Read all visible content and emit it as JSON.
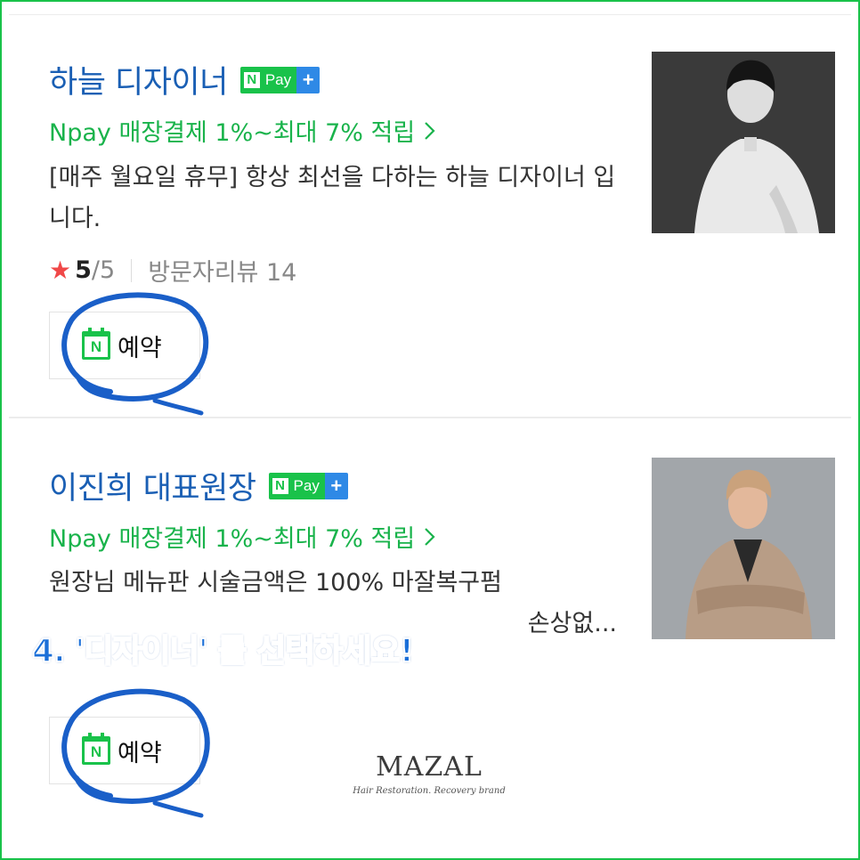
{
  "colors": {
    "frame": "#19c24a",
    "title": "#1a5fb4",
    "promo": "#19b34b",
    "star": "#f04848",
    "annotation": "#1b6fd8"
  },
  "npay_badge": {
    "n": "N",
    "pay": "Pay",
    "plus": "+"
  },
  "listings": [
    {
      "title": "하늘 디자이너",
      "promo": "Npay 매장결제 1%~최대 7% 적립",
      "description": "[매주 월요일 휴무] 항상 최선을 다하는 하늘 디자이너 입니다.",
      "rating": {
        "score": "5",
        "max": "/5",
        "reviews_label": "방문자리뷰 14"
      },
      "reserve_label": "예약",
      "photo_icon": "designer-portrait"
    },
    {
      "title": "이진희 대표원장",
      "promo": "Npay 매장결제 1%~최대 7% 적립",
      "description_line1": "원장님 메뉴판 시술금액은 100% 마잘복구펌",
      "description_line2": "손상없...",
      "reserve_label": "예약",
      "photo_icon": "director-portrait"
    }
  ],
  "annotation": "4. '디자이너' 를 선택하세요!",
  "brand": {
    "name": "MAZAL",
    "tagline": "Hair Restoration. Recovery brand"
  }
}
